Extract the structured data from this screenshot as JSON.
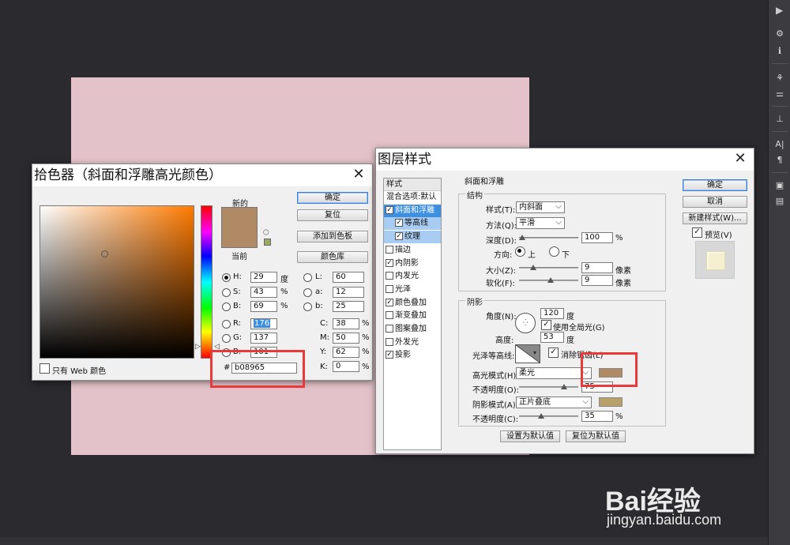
{
  "picker": {
    "title": "拾色器（斜面和浮雕高光颜色）",
    "new_label": "新的",
    "current_label": "当前",
    "color_hex": "#b08965",
    "buttons": {
      "ok": "确定",
      "reset": "复位",
      "add_swatch": "添加到色板",
      "library": "颜色库"
    },
    "fields": {
      "H": {
        "label": "H:",
        "value": "29",
        "unit": "度"
      },
      "S": {
        "label": "S:",
        "value": "43",
        "unit": "%"
      },
      "B": {
        "label": "B:",
        "value": "69",
        "unit": "%"
      },
      "R": {
        "label": "R:",
        "value": "176"
      },
      "G": {
        "label": "G:",
        "value": "137"
      },
      "Bb": {
        "label": "B:",
        "value": "101"
      },
      "L": {
        "label": "L:",
        "value": "60"
      },
      "a": {
        "label": "a:",
        "value": "12"
      },
      "b": {
        "label": "b:",
        "value": "25"
      },
      "C": {
        "label": "C:",
        "value": "38",
        "unit": "%"
      },
      "M": {
        "label": "M:",
        "value": "50",
        "unit": "%"
      },
      "Y": {
        "label": "Y:",
        "value": "62",
        "unit": "%"
      },
      "K": {
        "label": "K:",
        "value": "0",
        "unit": "%"
      }
    },
    "hex_label": "#",
    "hex_value": "b08965",
    "web_only": "只有 Web 颜色"
  },
  "layer_style": {
    "title": "图层样式",
    "list_header": "样式",
    "list": [
      {
        "label": "混合选项:默认",
        "checkbox": false,
        "checked": false
      },
      {
        "label": "斜面和浮雕",
        "checkbox": true,
        "checked": true
      },
      {
        "label": "等高线",
        "checkbox": true,
        "checked": true
      },
      {
        "label": "纹理",
        "checkbox": true,
        "checked": true
      },
      {
        "label": "描边",
        "checkbox": true,
        "checked": false
      },
      {
        "label": "内阴影",
        "checkbox": true,
        "checked": true
      },
      {
        "label": "内发光",
        "checkbox": true,
        "checked": false
      },
      {
        "label": "光泽",
        "checkbox": true,
        "checked": false
      },
      {
        "label": "颜色叠加",
        "checkbox": true,
        "checked": true
      },
      {
        "label": "渐变叠加",
        "checkbox": true,
        "checked": false
      },
      {
        "label": "图案叠加",
        "checkbox": true,
        "checked": false
      },
      {
        "label": "外发光",
        "checkbox": true,
        "checked": false
      },
      {
        "label": "投影",
        "checkbox": true,
        "checked": true
      }
    ],
    "section_title": "斜面和浮雕",
    "structure": {
      "title": "结构",
      "style_label": "样式(T):",
      "style_value": "内斜面",
      "method_label": "方法(Q):",
      "method_value": "平滑",
      "depth_label": "深度(D):",
      "depth_value": "100",
      "depth_unit": "%",
      "direction_label": "方向:",
      "up": "上",
      "down": "下",
      "size_label": "大小(Z):",
      "size_value": "9",
      "size_unit": "像素",
      "soften_label": "软化(F):",
      "soften_value": "9",
      "soften_unit": "像素"
    },
    "shading": {
      "title": "阴影",
      "angle_label": "角度(N):",
      "angle_value": "120",
      "angle_unit": "度",
      "global_light": "使用全局光(G)",
      "altitude_label": "高度:",
      "altitude_value": "53",
      "altitude_unit": "度",
      "gloss_label": "光泽等高线:",
      "antialias": "消除锯齿(L)",
      "highlight_label": "高光模式(H):",
      "highlight_value": "柔光",
      "highlight_color": "#b08965",
      "opacity1_label": "不透明度(O):",
      "opacity1_value": "75",
      "shadow_label": "阴影模式(A):",
      "shadow_value": "正片叠底",
      "shadow_color": "#b8a06a",
      "opacity2_label": "不透明度(C):",
      "opacity2_value": "35",
      "opacity_unit": "%"
    },
    "buttons": {
      "set_default": "设置为默认值",
      "reset_default": "复位为默认值",
      "ok": "确定",
      "cancel": "取消",
      "new_style": "新建样式(W)...",
      "preview": "预览(V)"
    }
  },
  "watermark": {
    "brand": "Bai经验",
    "url": "jingyan.baidu.com"
  }
}
